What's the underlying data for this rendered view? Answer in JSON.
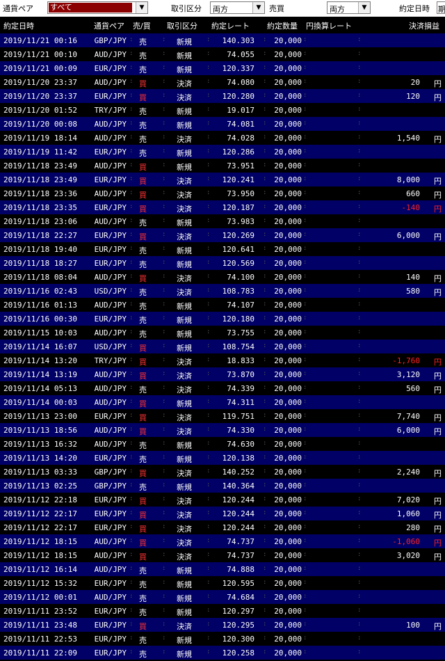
{
  "filters": {
    "pair_label": "通貨ペア",
    "pair_value": "すべて",
    "type_label": "取引区分",
    "type_value": "両方",
    "side_label": "売買",
    "side_value": "両方",
    "date_label": "約定日時",
    "date_value": "期"
  },
  "columns": {
    "datetime": "約定日時",
    "pair": "通貨ペア",
    "side": "売/買",
    "type": "取引区分",
    "rate": "約定レート",
    "qty": "約定数量",
    "yen_rate": "円換算レート",
    "pnl": "決済損益"
  },
  "yen_unit": "円",
  "colors": {
    "blue_row": "#000066",
    "black_row": "#000000",
    "buy": "#ff3333",
    "loss": "#ff2222"
  },
  "rows": [
    {
      "dt": "2019/11/21 00:16",
      "pair": "GBP/JPY",
      "side": "売",
      "type": "新規",
      "rate": "140.303",
      "qty": "20,000",
      "pnl": ""
    },
    {
      "dt": "2019/11/21 00:10",
      "pair": "AUD/JPY",
      "side": "売",
      "type": "新規",
      "rate": "74.055",
      "qty": "20,000",
      "pnl": ""
    },
    {
      "dt": "2019/11/21 00:09",
      "pair": "EUR/JPY",
      "side": "売",
      "type": "新規",
      "rate": "120.337",
      "qty": "20,000",
      "pnl": ""
    },
    {
      "dt": "2019/11/20 23:37",
      "pair": "AUD/JPY",
      "side": "買",
      "type": "決済",
      "rate": "74.080",
      "qty": "20,000",
      "pnl": "20"
    },
    {
      "dt": "2019/11/20 23:37",
      "pair": "EUR/JPY",
      "side": "買",
      "type": "決済",
      "rate": "120.280",
      "qty": "20,000",
      "pnl": "120"
    },
    {
      "dt": "2019/11/20 01:52",
      "pair": "TRY/JPY",
      "side": "売",
      "type": "新規",
      "rate": "19.017",
      "qty": "20,000",
      "pnl": ""
    },
    {
      "dt": "2019/11/20 00:08",
      "pair": "AUD/JPY",
      "side": "売",
      "type": "新規",
      "rate": "74.081",
      "qty": "20,000",
      "pnl": ""
    },
    {
      "dt": "2019/11/19 18:14",
      "pair": "AUD/JPY",
      "side": "売",
      "type": "決済",
      "rate": "74.028",
      "qty": "20,000",
      "pnl": "1,540"
    },
    {
      "dt": "2019/11/19 11:42",
      "pair": "EUR/JPY",
      "side": "売",
      "type": "新規",
      "rate": "120.286",
      "qty": "20,000",
      "pnl": ""
    },
    {
      "dt": "2019/11/18 23:49",
      "pair": "AUD/JPY",
      "side": "買",
      "type": "新規",
      "rate": "73.951",
      "qty": "20,000",
      "pnl": ""
    },
    {
      "dt": "2019/11/18 23:49",
      "pair": "EUR/JPY",
      "side": "買",
      "type": "決済",
      "rate": "120.241",
      "qty": "20,000",
      "pnl": "8,000"
    },
    {
      "dt": "2019/11/18 23:36",
      "pair": "AUD/JPY",
      "side": "買",
      "type": "決済",
      "rate": "73.950",
      "qty": "20,000",
      "pnl": "660"
    },
    {
      "dt": "2019/11/18 23:35",
      "pair": "EUR/JPY",
      "side": "買",
      "type": "決済",
      "rate": "120.187",
      "qty": "20,000",
      "pnl": "-140"
    },
    {
      "dt": "2019/11/18 23:06",
      "pair": "AUD/JPY",
      "side": "売",
      "type": "新規",
      "rate": "73.983",
      "qty": "20,000",
      "pnl": ""
    },
    {
      "dt": "2019/11/18 22:27",
      "pair": "EUR/JPY",
      "side": "買",
      "type": "決済",
      "rate": "120.269",
      "qty": "20,000",
      "pnl": "6,000"
    },
    {
      "dt": "2019/11/18 19:40",
      "pair": "EUR/JPY",
      "side": "売",
      "type": "新規",
      "rate": "120.641",
      "qty": "20,000",
      "pnl": ""
    },
    {
      "dt": "2019/11/18 18:27",
      "pair": "EUR/JPY",
      "side": "売",
      "type": "新規",
      "rate": "120.569",
      "qty": "20,000",
      "pnl": ""
    },
    {
      "dt": "2019/11/18 08:04",
      "pair": "AUD/JPY",
      "side": "買",
      "type": "決済",
      "rate": "74.100",
      "qty": "20,000",
      "pnl": "140"
    },
    {
      "dt": "2019/11/16 02:43",
      "pair": "USD/JPY",
      "side": "売",
      "type": "決済",
      "rate": "108.783",
      "qty": "20,000",
      "pnl": "580"
    },
    {
      "dt": "2019/11/16 01:13",
      "pair": "AUD/JPY",
      "side": "売",
      "type": "新規",
      "rate": "74.107",
      "qty": "20,000",
      "pnl": ""
    },
    {
      "dt": "2019/11/16 00:30",
      "pair": "EUR/JPY",
      "side": "売",
      "type": "新規",
      "rate": "120.180",
      "qty": "20,000",
      "pnl": ""
    },
    {
      "dt": "2019/11/15 10:03",
      "pair": "AUD/JPY",
      "side": "売",
      "type": "新規",
      "rate": "73.755",
      "qty": "20,000",
      "pnl": ""
    },
    {
      "dt": "2019/11/14 16:07",
      "pair": "USD/JPY",
      "side": "買",
      "type": "新規",
      "rate": "108.754",
      "qty": "20,000",
      "pnl": ""
    },
    {
      "dt": "2019/11/14 13:20",
      "pair": "TRY/JPY",
      "side": "買",
      "type": "決済",
      "rate": "18.833",
      "qty": "20,000",
      "pnl": "-1,760"
    },
    {
      "dt": "2019/11/14 13:19",
      "pair": "AUD/JPY",
      "side": "買",
      "type": "決済",
      "rate": "73.870",
      "qty": "20,000",
      "pnl": "3,120"
    },
    {
      "dt": "2019/11/14 05:13",
      "pair": "AUD/JPY",
      "side": "売",
      "type": "決済",
      "rate": "74.339",
      "qty": "20,000",
      "pnl": "560"
    },
    {
      "dt": "2019/11/14 00:03",
      "pair": "AUD/JPY",
      "side": "買",
      "type": "新規",
      "rate": "74.311",
      "qty": "20,000",
      "pnl": ""
    },
    {
      "dt": "2019/11/13 23:00",
      "pair": "EUR/JPY",
      "side": "買",
      "type": "決済",
      "rate": "119.751",
      "qty": "20,000",
      "pnl": "7,740"
    },
    {
      "dt": "2019/11/13 18:56",
      "pair": "AUD/JPY",
      "side": "買",
      "type": "決済",
      "rate": "74.330",
      "qty": "20,000",
      "pnl": "6,000"
    },
    {
      "dt": "2019/11/13 16:32",
      "pair": "AUD/JPY",
      "side": "売",
      "type": "新規",
      "rate": "74.630",
      "qty": "20,000",
      "pnl": ""
    },
    {
      "dt": "2019/11/13 14:20",
      "pair": "EUR/JPY",
      "side": "売",
      "type": "新規",
      "rate": "120.138",
      "qty": "20,000",
      "pnl": ""
    },
    {
      "dt": "2019/11/13 03:33",
      "pair": "GBP/JPY",
      "side": "買",
      "type": "決済",
      "rate": "140.252",
      "qty": "20,000",
      "pnl": "2,240"
    },
    {
      "dt": "2019/11/13 02:25",
      "pair": "GBP/JPY",
      "side": "売",
      "type": "新規",
      "rate": "140.364",
      "qty": "20,000",
      "pnl": ""
    },
    {
      "dt": "2019/11/12 22:18",
      "pair": "EUR/JPY",
      "side": "買",
      "type": "決済",
      "rate": "120.244",
      "qty": "20,000",
      "pnl": "7,020"
    },
    {
      "dt": "2019/11/12 22:17",
      "pair": "EUR/JPY",
      "side": "買",
      "type": "決済",
      "rate": "120.244",
      "qty": "20,000",
      "pnl": "1,060"
    },
    {
      "dt": "2019/11/12 22:17",
      "pair": "EUR/JPY",
      "side": "買",
      "type": "決済",
      "rate": "120.244",
      "qty": "20,000",
      "pnl": "280"
    },
    {
      "dt": "2019/11/12 18:15",
      "pair": "AUD/JPY",
      "side": "買",
      "type": "決済",
      "rate": "74.737",
      "qty": "20,000",
      "pnl": "-1,060"
    },
    {
      "dt": "2019/11/12 18:15",
      "pair": "AUD/JPY",
      "side": "買",
      "type": "決済",
      "rate": "74.737",
      "qty": "20,000",
      "pnl": "3,020"
    },
    {
      "dt": "2019/11/12 16:14",
      "pair": "AUD/JPY",
      "side": "売",
      "type": "新規",
      "rate": "74.888",
      "qty": "20,000",
      "pnl": ""
    },
    {
      "dt": "2019/11/12 15:32",
      "pair": "EUR/JPY",
      "side": "売",
      "type": "新規",
      "rate": "120.595",
      "qty": "20,000",
      "pnl": ""
    },
    {
      "dt": "2019/11/12 00:01",
      "pair": "AUD/JPY",
      "side": "売",
      "type": "新規",
      "rate": "74.684",
      "qty": "20,000",
      "pnl": ""
    },
    {
      "dt": "2019/11/11 23:52",
      "pair": "EUR/JPY",
      "side": "売",
      "type": "新規",
      "rate": "120.297",
      "qty": "20,000",
      "pnl": ""
    },
    {
      "dt": "2019/11/11 23:48",
      "pair": "EUR/JPY",
      "side": "買",
      "type": "決済",
      "rate": "120.295",
      "qty": "20,000",
      "pnl": "100"
    },
    {
      "dt": "2019/11/11 22:53",
      "pair": "EUR/JPY",
      "side": "売",
      "type": "新規",
      "rate": "120.300",
      "qty": "20,000",
      "pnl": ""
    },
    {
      "dt": "2019/11/11 22:09",
      "pair": "EUR/JPY",
      "side": "売",
      "type": "新規",
      "rate": "120.258",
      "qty": "20,000",
      "pnl": ""
    }
  ]
}
